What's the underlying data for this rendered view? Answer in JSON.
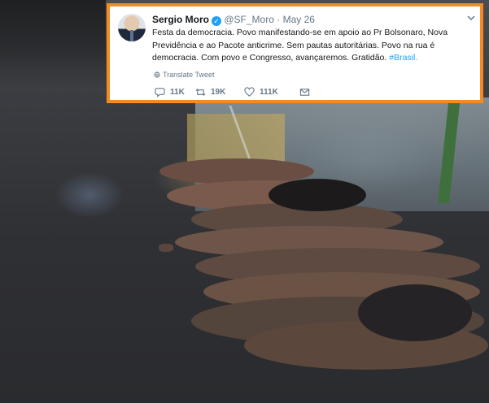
{
  "tweet": {
    "author_name": "Sergio Moro",
    "handle": "@SF_Moro",
    "separator": "·",
    "date": "May 26",
    "text": "Festa da democracia. Povo manifestando-se em apoio ao Pr Bolsonaro, Nova Previdência e ao Pacote anticrime. Sem pautas autoritárias. Povo na rua é democracia. Com povo e Congresso, avançaremos. Gratidão. ",
    "hashtag": "#Brasil.",
    "translate_label": "Translate Tweet",
    "reply_count": "11K",
    "retweet_count": "19K",
    "like_count": "111K",
    "highlight_color": "#f48a22",
    "link_color": "#1da1f2",
    "icons": [
      "verified-badge-icon",
      "chevron-down-icon",
      "globe-icon",
      "reply-icon",
      "retweet-icon",
      "like-icon",
      "message-icon"
    ]
  }
}
